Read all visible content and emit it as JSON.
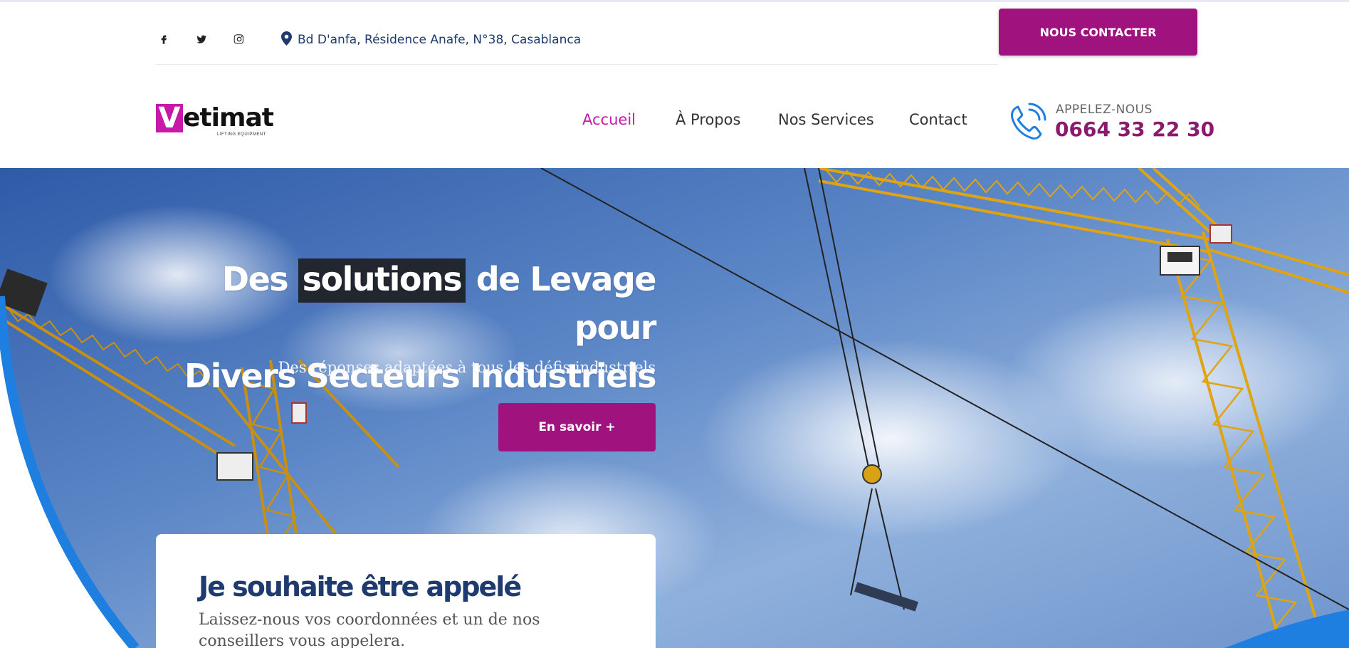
{
  "topbar": {
    "social": [
      {
        "icon": "facebook-icon",
        "label": "f"
      },
      {
        "icon": "twitter-icon",
        "label": "t"
      },
      {
        "icon": "instagram-icon",
        "label": "i"
      }
    ],
    "address": "Bd D'anfa, Résidence Anafe, N°38, Casablanca",
    "contact_button": "NOUS CONTACTER"
  },
  "header": {
    "logo": {
      "letter": "V",
      "word": "etimat",
      "tagline": "LIFTING EQUIPMENT"
    },
    "nav": [
      {
        "label": "Accueil",
        "active": true
      },
      {
        "label": "À Propos",
        "active": false
      },
      {
        "label": "Nos Services",
        "active": false
      },
      {
        "label": "Contact",
        "active": false
      }
    ],
    "call": {
      "label": "APPELEZ-NOUS",
      "number": "0664 33 22 30"
    }
  },
  "hero": {
    "title_before": "Des",
    "title_highlight": "solutions",
    "title_after": "de Levage pour",
    "title_line2": "Divers Secteurs Industriels",
    "subtitle": "Des réponses adaptées à tous les défis industriels",
    "button": "En savoir +"
  },
  "callback_card": {
    "title": "Je souhaite être appelé",
    "text": "Laissez-nous vos coordonnées et un de nos conseillers vous appelera."
  },
  "colors": {
    "brand_magenta": "#c619a8",
    "button_purple": "#a0137e",
    "navy": "#1e3a6e",
    "accent_blue": "#1f7fe0"
  }
}
